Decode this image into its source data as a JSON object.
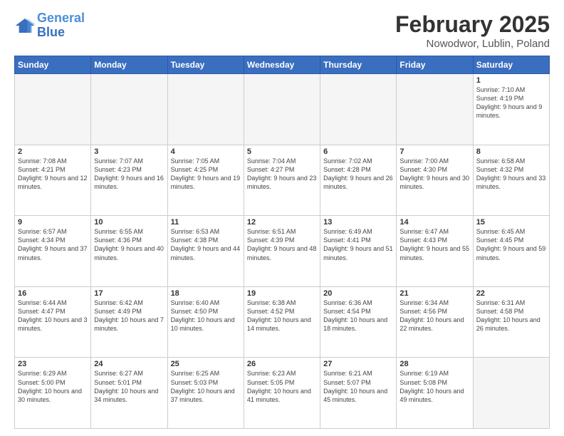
{
  "header": {
    "logo_line1": "General",
    "logo_line2": "Blue",
    "title": "February 2025",
    "subtitle": "Nowodwor, Lublin, Poland"
  },
  "days_of_week": [
    "Sunday",
    "Monday",
    "Tuesday",
    "Wednesday",
    "Thursday",
    "Friday",
    "Saturday"
  ],
  "weeks": [
    [
      {
        "day": "",
        "info": ""
      },
      {
        "day": "",
        "info": ""
      },
      {
        "day": "",
        "info": ""
      },
      {
        "day": "",
        "info": ""
      },
      {
        "day": "",
        "info": ""
      },
      {
        "day": "",
        "info": ""
      },
      {
        "day": "1",
        "info": "Sunrise: 7:10 AM\nSunset: 4:19 PM\nDaylight: 9 hours\nand 9 minutes."
      }
    ],
    [
      {
        "day": "2",
        "info": "Sunrise: 7:08 AM\nSunset: 4:21 PM\nDaylight: 9 hours\nand 12 minutes."
      },
      {
        "day": "3",
        "info": "Sunrise: 7:07 AM\nSunset: 4:23 PM\nDaylight: 9 hours\nand 16 minutes."
      },
      {
        "day": "4",
        "info": "Sunrise: 7:05 AM\nSunset: 4:25 PM\nDaylight: 9 hours\nand 19 minutes."
      },
      {
        "day": "5",
        "info": "Sunrise: 7:04 AM\nSunset: 4:27 PM\nDaylight: 9 hours\nand 23 minutes."
      },
      {
        "day": "6",
        "info": "Sunrise: 7:02 AM\nSunset: 4:28 PM\nDaylight: 9 hours\nand 26 minutes."
      },
      {
        "day": "7",
        "info": "Sunrise: 7:00 AM\nSunset: 4:30 PM\nDaylight: 9 hours\nand 30 minutes."
      },
      {
        "day": "8",
        "info": "Sunrise: 6:58 AM\nSunset: 4:32 PM\nDaylight: 9 hours\nand 33 minutes."
      }
    ],
    [
      {
        "day": "9",
        "info": "Sunrise: 6:57 AM\nSunset: 4:34 PM\nDaylight: 9 hours\nand 37 minutes."
      },
      {
        "day": "10",
        "info": "Sunrise: 6:55 AM\nSunset: 4:36 PM\nDaylight: 9 hours\nand 40 minutes."
      },
      {
        "day": "11",
        "info": "Sunrise: 6:53 AM\nSunset: 4:38 PM\nDaylight: 9 hours\nand 44 minutes."
      },
      {
        "day": "12",
        "info": "Sunrise: 6:51 AM\nSunset: 4:39 PM\nDaylight: 9 hours\nand 48 minutes."
      },
      {
        "day": "13",
        "info": "Sunrise: 6:49 AM\nSunset: 4:41 PM\nDaylight: 9 hours\nand 51 minutes."
      },
      {
        "day": "14",
        "info": "Sunrise: 6:47 AM\nSunset: 4:43 PM\nDaylight: 9 hours\nand 55 minutes."
      },
      {
        "day": "15",
        "info": "Sunrise: 6:45 AM\nSunset: 4:45 PM\nDaylight: 9 hours\nand 59 minutes."
      }
    ],
    [
      {
        "day": "16",
        "info": "Sunrise: 6:44 AM\nSunset: 4:47 PM\nDaylight: 10 hours\nand 3 minutes."
      },
      {
        "day": "17",
        "info": "Sunrise: 6:42 AM\nSunset: 4:49 PM\nDaylight: 10 hours\nand 7 minutes."
      },
      {
        "day": "18",
        "info": "Sunrise: 6:40 AM\nSunset: 4:50 PM\nDaylight: 10 hours\nand 10 minutes."
      },
      {
        "day": "19",
        "info": "Sunrise: 6:38 AM\nSunset: 4:52 PM\nDaylight: 10 hours\nand 14 minutes."
      },
      {
        "day": "20",
        "info": "Sunrise: 6:36 AM\nSunset: 4:54 PM\nDaylight: 10 hours\nand 18 minutes."
      },
      {
        "day": "21",
        "info": "Sunrise: 6:34 AM\nSunset: 4:56 PM\nDaylight: 10 hours\nand 22 minutes."
      },
      {
        "day": "22",
        "info": "Sunrise: 6:31 AM\nSunset: 4:58 PM\nDaylight: 10 hours\nand 26 minutes."
      }
    ],
    [
      {
        "day": "23",
        "info": "Sunrise: 6:29 AM\nSunset: 5:00 PM\nDaylight: 10 hours\nand 30 minutes."
      },
      {
        "day": "24",
        "info": "Sunrise: 6:27 AM\nSunset: 5:01 PM\nDaylight: 10 hours\nand 34 minutes."
      },
      {
        "day": "25",
        "info": "Sunrise: 6:25 AM\nSunset: 5:03 PM\nDaylight: 10 hours\nand 37 minutes."
      },
      {
        "day": "26",
        "info": "Sunrise: 6:23 AM\nSunset: 5:05 PM\nDaylight: 10 hours\nand 41 minutes."
      },
      {
        "day": "27",
        "info": "Sunrise: 6:21 AM\nSunset: 5:07 PM\nDaylight: 10 hours\nand 45 minutes."
      },
      {
        "day": "28",
        "info": "Sunrise: 6:19 AM\nSunset: 5:08 PM\nDaylight: 10 hours\nand 49 minutes."
      },
      {
        "day": "",
        "info": ""
      }
    ]
  ]
}
